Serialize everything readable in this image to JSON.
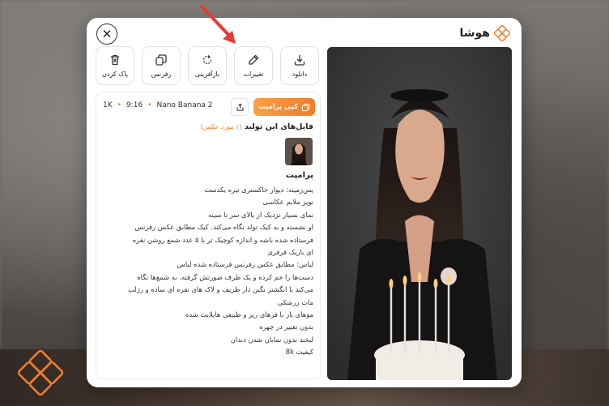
{
  "brand": {
    "name": "هوشا"
  },
  "toolbar": [
    {
      "label": "پاک کردن",
      "icon": "trash-icon"
    },
    {
      "label": "رفرنس",
      "icon": "layers-icon"
    },
    {
      "label": "بازآفرینی",
      "icon": "regenerate-icon"
    },
    {
      "label": "تغییرات",
      "icon": "pencil-icon"
    },
    {
      "label": "دانلود",
      "icon": "download-icon"
    }
  ],
  "panel": {
    "copy_label": "کپی پرامپت",
    "meta": {
      "model": "Nano Banana 2",
      "ratio": "9:16",
      "resolution": "1K"
    },
    "files_title": "فایل‌های این تولید",
    "files_count": "(۱ مورد عکس)",
    "prompt_title": "پرامپت",
    "prompt_lines": [
      "پس‌زمینه: دیوار خاکستری تیره یکدست",
      "نویز ملایم عکاسی",
      "نمای بسیار نزدیک از بالای سر تا سینه",
      "او نشسته و به کیک تولد نگاه می‌کند. کیک مطابق عکس رفرنس",
      "فرستاده شده باشه و اندازه کوچیک تر با ۵ عدد شمع روشن نقره",
      "ای باریک فرفری",
      "لباس: مطابق عکس رفرنس فرستاده شده لباس",
      "دست‌ها را خم کرده و یک طرف صورتش گرفته. به شمع‌ها نگاه",
      "می‌کند با انگشتر نگین دار ظریف و لاک های نقره ای ساده و رژلب",
      "مات زرشکی",
      "موهای باز با فرهای ریز و طبیعی هایلایت شده",
      "بدون تغییر در چهره",
      "لبخند بدون نمایان شدن دندان",
      "کیفیت 8k"
    ]
  },
  "colors": {
    "accent": "#f07b2a",
    "arrow": "#e53935"
  }
}
